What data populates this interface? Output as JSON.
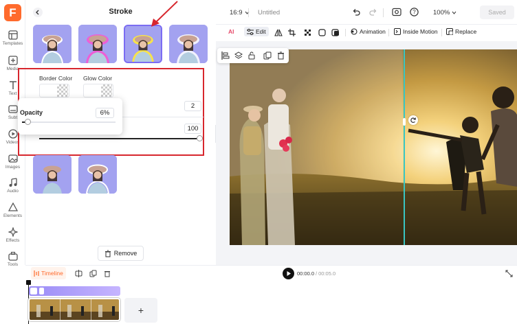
{
  "rail": {
    "logo": "F",
    "items": [
      {
        "label": "Templates",
        "icon": "templates-icon"
      },
      {
        "label": "Media",
        "icon": "media-icon"
      },
      {
        "label": "Text",
        "icon": "text-icon"
      },
      {
        "label": "Subt",
        "icon": "subtitle-icon"
      },
      {
        "label": "Videos",
        "icon": "videos-icon"
      },
      {
        "label": "Images",
        "icon": "images-icon"
      },
      {
        "label": "Audio",
        "icon": "audio-icon"
      },
      {
        "label": "Elements",
        "icon": "elements-icon"
      },
      {
        "label": "Effects",
        "icon": "effects-icon"
      },
      {
        "label": "Tools",
        "icon": "tools-icon"
      }
    ]
  },
  "panel": {
    "title": "Stroke",
    "border_color_label": "Border Color",
    "glow_color_label": "Glow Color",
    "stroke_width_value": "2",
    "stroke_size_value": "100",
    "opacity_label": "Opacity",
    "opacity_value": "6%",
    "opacity_fraction": 0.06,
    "remove_label": "Remove",
    "stroke_styles": [
      {
        "name": "white-border"
      },
      {
        "name": "pink-glow"
      },
      {
        "name": "yellow-glow",
        "selected": true
      },
      {
        "name": "white-glow"
      },
      {
        "name": "soft-edge"
      },
      {
        "name": "white-outline"
      }
    ]
  },
  "topbar": {
    "aspect_ratio": "16:9",
    "project_title": "Untitled",
    "zoom": "100%",
    "saved_label": "Saved"
  },
  "toolbar": {
    "ai_label": "AI",
    "edit_label": "Edit",
    "animation_label": "Animation",
    "inside_motion_label": "Inside Motion",
    "replace_label": "Replace"
  },
  "timeline": {
    "label": "Timeline",
    "current_time": "00:00.0",
    "separator": "/",
    "total_time": "00:05.0",
    "add_label": "+"
  },
  "colors": {
    "brand": "#ff6a2c",
    "accent": "#7b6cf2",
    "highlight_box": "#d7262d",
    "guide_line": "#39c6c4"
  }
}
